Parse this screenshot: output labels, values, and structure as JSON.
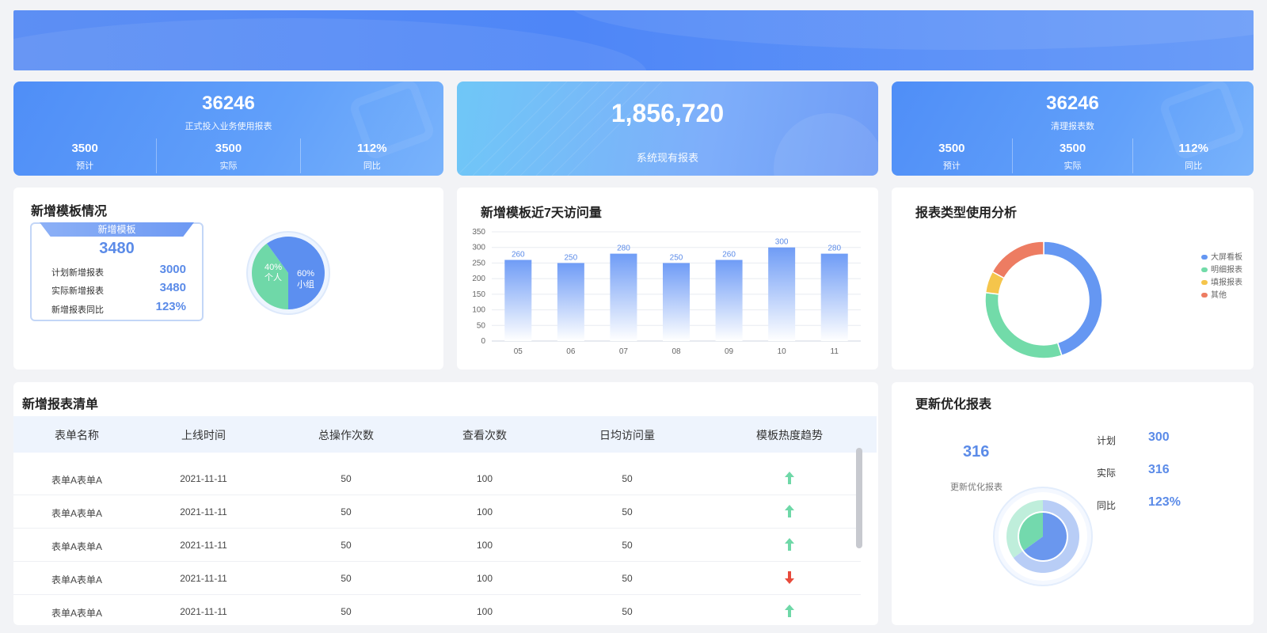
{
  "kpi_left": {
    "value": "36246",
    "label": "正式投入业务使用报表",
    "cols": [
      {
        "value": "3500",
        "label": "预计"
      },
      {
        "value": "3500",
        "label": "实际"
      },
      {
        "value": "112%",
        "label": "同比"
      }
    ]
  },
  "kpi_center": {
    "value": "1,856,720",
    "label": "系统现有报表"
  },
  "kpi_right": {
    "value": "36246",
    "label": "清理报表数",
    "cols": [
      {
        "value": "3500",
        "label": "预计"
      },
      {
        "value": "3500",
        "label": "实际"
      },
      {
        "value": "112%",
        "label": "同比"
      }
    ]
  },
  "new_template": {
    "title": "新增模板情况",
    "box_title": "新增模板",
    "box_value": "3480",
    "rows": [
      {
        "label": "计划新增报表",
        "value": "3000"
      },
      {
        "label": "实际新增报表",
        "value": "3480"
      },
      {
        "label": "新增报表同比",
        "value": "123%"
      }
    ],
    "pie": {
      "slices": [
        {
          "pct_label": "40%",
          "name": "个人",
          "value": 40,
          "color": "#6fd8a8"
        },
        {
          "pct_label": "60%",
          "name": "小组",
          "value": 60,
          "color": "#5c8ff0"
        }
      ]
    }
  },
  "chart_visits": {
    "title": "新增模板近7天访问量"
  },
  "chart_data": [
    {
      "type": "bar",
      "title": "新增模板近7天访问量",
      "categories": [
        "05",
        "06",
        "07",
        "08",
        "09",
        "10",
        "11"
      ],
      "values": [
        260,
        250,
        280,
        250,
        260,
        300,
        280
      ],
      "ylim": [
        0,
        350
      ],
      "yticks": [
        "0",
        "50",
        "100",
        "150",
        "200",
        "250",
        "300",
        "350"
      ],
      "grid": true,
      "color": "#6f9cf6"
    },
    {
      "type": "pie",
      "title": "报表类型使用分析",
      "categories": [
        "大屏看板",
        "明细报表",
        "填报报表",
        "其他"
      ],
      "values": [
        45,
        32,
        6,
        17
      ],
      "colors": [
        "#6597f2",
        "#72dba9",
        "#f5c54b",
        "#ed7c62"
      ],
      "legend": "right"
    }
  ],
  "type_usage": {
    "title": "报表类型使用分析",
    "legend": [
      "大屏看板",
      "明细报表",
      "填报报表",
      "其他"
    ]
  },
  "report_list": {
    "title": "新增报表清单",
    "columns": [
      "表单名称",
      "上线时间",
      "总操作次数",
      "查看次数",
      "日均访问量",
      "模板热度趋势"
    ],
    "rows": [
      {
        "name": "表单A表单A",
        "date": "2021-11-11",
        "ops": "50",
        "views": "100",
        "daily": "50",
        "trend": "up"
      },
      {
        "name": "表单A表单A",
        "date": "2021-11-11",
        "ops": "50",
        "views": "100",
        "daily": "50",
        "trend": "up"
      },
      {
        "name": "表单A表单A",
        "date": "2021-11-11",
        "ops": "50",
        "views": "100",
        "daily": "50",
        "trend": "up"
      },
      {
        "name": "表单A表单A",
        "date": "2021-11-11",
        "ops": "50",
        "views": "100",
        "daily": "50",
        "trend": "down"
      },
      {
        "name": "表单A表单A",
        "date": "2021-11-11",
        "ops": "50",
        "views": "100",
        "daily": "50",
        "trend": "up"
      }
    ]
  },
  "optimize": {
    "title": "更新优化报表",
    "value": "316",
    "label": "更新优化报表",
    "rows": [
      {
        "label": "计划",
        "value": "300"
      },
      {
        "label": "实际",
        "value": "316"
      },
      {
        "label": "同比",
        "value": "123%"
      }
    ]
  }
}
